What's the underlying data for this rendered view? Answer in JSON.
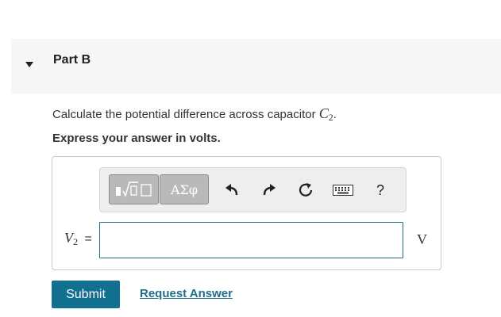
{
  "part": {
    "title": "Part B"
  },
  "question": {
    "prefix": "Calculate the potential difference across capacitor ",
    "variable": "C",
    "subscript": "2",
    "suffix": "."
  },
  "instruction": "Express your answer in volts.",
  "toolbar": {
    "symbols_label": "ΑΣφ",
    "help_label": "?"
  },
  "answer": {
    "variable": "V",
    "subscript": "2",
    "equals": "=",
    "value": "",
    "unit": "V"
  },
  "actions": {
    "submit_label": "Submit",
    "request_label": "Request Answer"
  },
  "colors": {
    "submit_bg": "#11708f",
    "link": "#1f6f8b",
    "input_border": "#1e6f86"
  }
}
